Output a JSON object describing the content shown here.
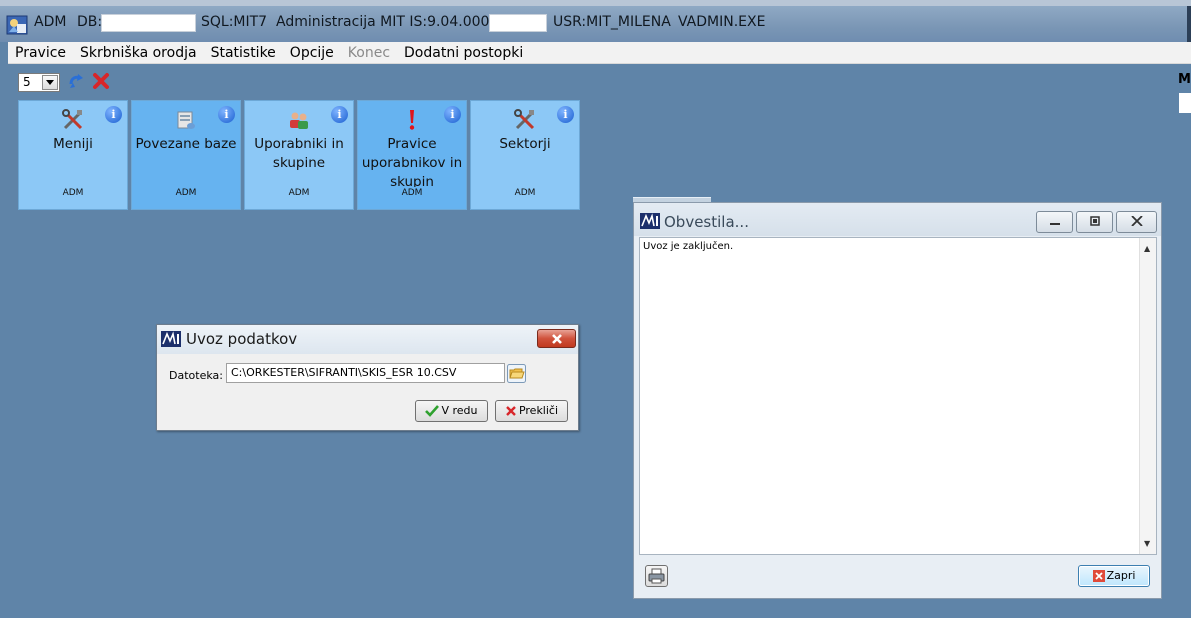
{
  "titlebar": {
    "app": "ADM",
    "db_label": "DB:",
    "sql": "SQL:MIT7",
    "product": "Administracija MIT IS:9.04.0000",
    "user": "USR:MIT_MILENA",
    "exe": "VADMIN.EXE"
  },
  "menu": [
    {
      "label": "Pravice",
      "enabled": true
    },
    {
      "label": "Skrbniška orodja",
      "enabled": true
    },
    {
      "label": "Statistike",
      "enabled": true
    },
    {
      "label": "Opcije",
      "enabled": true
    },
    {
      "label": "Konec",
      "enabled": false
    },
    {
      "label": "Dodatni postopki",
      "enabled": true
    }
  ],
  "toolbar": {
    "level_value": "5",
    "refresh_icon": "refresh-icon",
    "cancel_icon": "red-x-icon",
    "right_letter": "M"
  },
  "tiles": [
    {
      "label": "Meniji",
      "sub": "ADM",
      "icon": "tools-icon",
      "active": false
    },
    {
      "label": "Povezane baze",
      "sub": "ADM",
      "icon": "database-icon",
      "active": true
    },
    {
      "label": "Uporabniki in skupine",
      "sub": "ADM",
      "icon": "users-icon",
      "active": false
    },
    {
      "label": "Pravice uporabnikov in skupin",
      "sub": "ADM",
      "icon": "exclamation-icon",
      "active": true
    },
    {
      "label": "Sektorji",
      "sub": "ADM",
      "icon": "tools-icon",
      "active": false
    }
  ],
  "info_glyph": "i",
  "uvoz_dialog": {
    "title": "Uvoz podatkov",
    "file_label": "Datoteka:",
    "file_value": "C:\\ORKESTER\\SIFRANTI\\SKIS_ESR 10.CSV",
    "ok_label": "V redu",
    "cancel_label": "Prekliči"
  },
  "obvestila_dialog": {
    "title": "Obvestila...",
    "message": "Uvoz je zaključen.",
    "close_label": "Zapri"
  },
  "colors": {
    "desktop": "#5f84a8",
    "tile": "#8cc8f6",
    "tile_active": "#66b3f0"
  }
}
